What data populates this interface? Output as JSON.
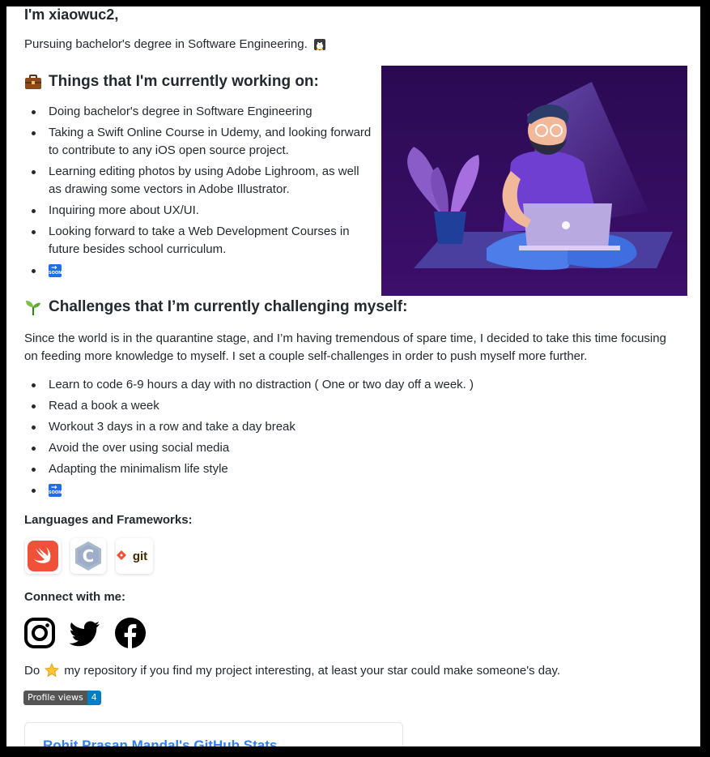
{
  "header": {
    "greeting": "I'm xiaowuc2,",
    "subtitle": "Pursuing bachelor's degree in Software Engineering."
  },
  "working": {
    "title": "Things that I'm currently working on:",
    "items": [
      "Doing bachelor's degree in Software Engineering",
      "Taking a Swift Online Course in Udemy, and looking forward to contribute to any iOS open source project.",
      "Learning editing photos by using Adobe Lighroom, as well as drawing some vectors in Adobe Illustrator.",
      "Inquiring more about UX/UI.",
      "Looking forward to take a Web Development Courses in future besides school curriculum."
    ]
  },
  "challenges": {
    "title": "Challenges that I’m currently challenging myself:",
    "paragraph": "Since the world is in the quarantine stage, and I’m having tremendous of spare time, I decided to take this time focusing on feeding more knowledge to myself. I set a couple self-challenges in order to push myself more further.",
    "items": [
      "Learn to code 6-9 hours a day with no distraction ( One or two day off a week. )",
      "Read a book a week",
      "Workout 3 days in a row and take a day break",
      "Avoid the over using social media",
      "Adapting the minimalism life style"
    ]
  },
  "languages": {
    "title": "Languages and Frameworks:",
    "icons": [
      "swift-icon",
      "c-icon",
      "git-icon"
    ],
    "git_label": "git"
  },
  "connect": {
    "title": "Connect with me:",
    "icons": [
      "instagram-icon",
      "twitter-icon",
      "facebook-icon"
    ]
  },
  "star_line": {
    "before": "Do",
    "after": "my repository if you find my project interesting, at least your star could make someone's day."
  },
  "badge": {
    "label": "Profile views",
    "count": "4"
  },
  "stats_card": {
    "title": "Rohit Prasan Mandal's GitHub Stats"
  },
  "colors": {
    "accent": "#2f80ed",
    "illustration_bg": "#3b0a63",
    "badge_value": "#007ec6"
  }
}
